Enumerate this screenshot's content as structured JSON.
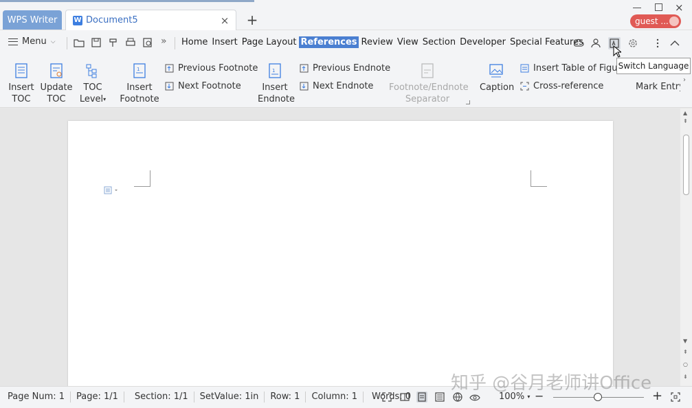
{
  "titlebar": {
    "app_tab": "WPS Writer",
    "doc_tab": "Document5",
    "doc_icon": "W",
    "close_glyph": "×",
    "add_glyph": "+",
    "user": "guest ..."
  },
  "menubar": {
    "menu_label": "Menu",
    "items": [
      "Home",
      "Insert",
      "Page Layout",
      "References",
      "Review",
      "View",
      "Section",
      "Developer",
      "Special Features"
    ],
    "active": "References",
    "more_glyph": "»"
  },
  "tooltip": "Switch Language",
  "ribbon": {
    "insert_toc": [
      "Insert",
      "TOC"
    ],
    "update_toc": [
      "Update",
      "TOC"
    ],
    "toc_level": [
      "TOC",
      "Level"
    ],
    "insert_footnote": [
      "Insert",
      "Footnote"
    ],
    "previous_footnote": "Previous Footnote",
    "next_footnote": "Next Footnote",
    "insert_endnote": [
      "Insert",
      "Endnote"
    ],
    "previous_endnote": "Previous Endnote",
    "next_endnote": "Next Endnote",
    "separator": [
      "Footnote/Endnote",
      "Separator"
    ],
    "caption": "Caption",
    "insert_table_of_figures": "Insert Table of Figure",
    "cross_reference": "Cross-reference",
    "mark_entry": "Mark Entry"
  },
  "statusbar": {
    "page_num": "Page Num: 1",
    "page": "Page: 1/1",
    "section": "Section: 1/1",
    "setvalue": "SetValue: 1in",
    "row": "Row: 1",
    "column": "Column: 1",
    "words": "Words: 0",
    "zoom": "100%"
  },
  "watermark": "知乎 @谷月老师讲Office",
  "colors": {
    "accent": "#4a7fd1",
    "app_tab": "#7aa2d6",
    "user_badge": "#e05a55"
  }
}
